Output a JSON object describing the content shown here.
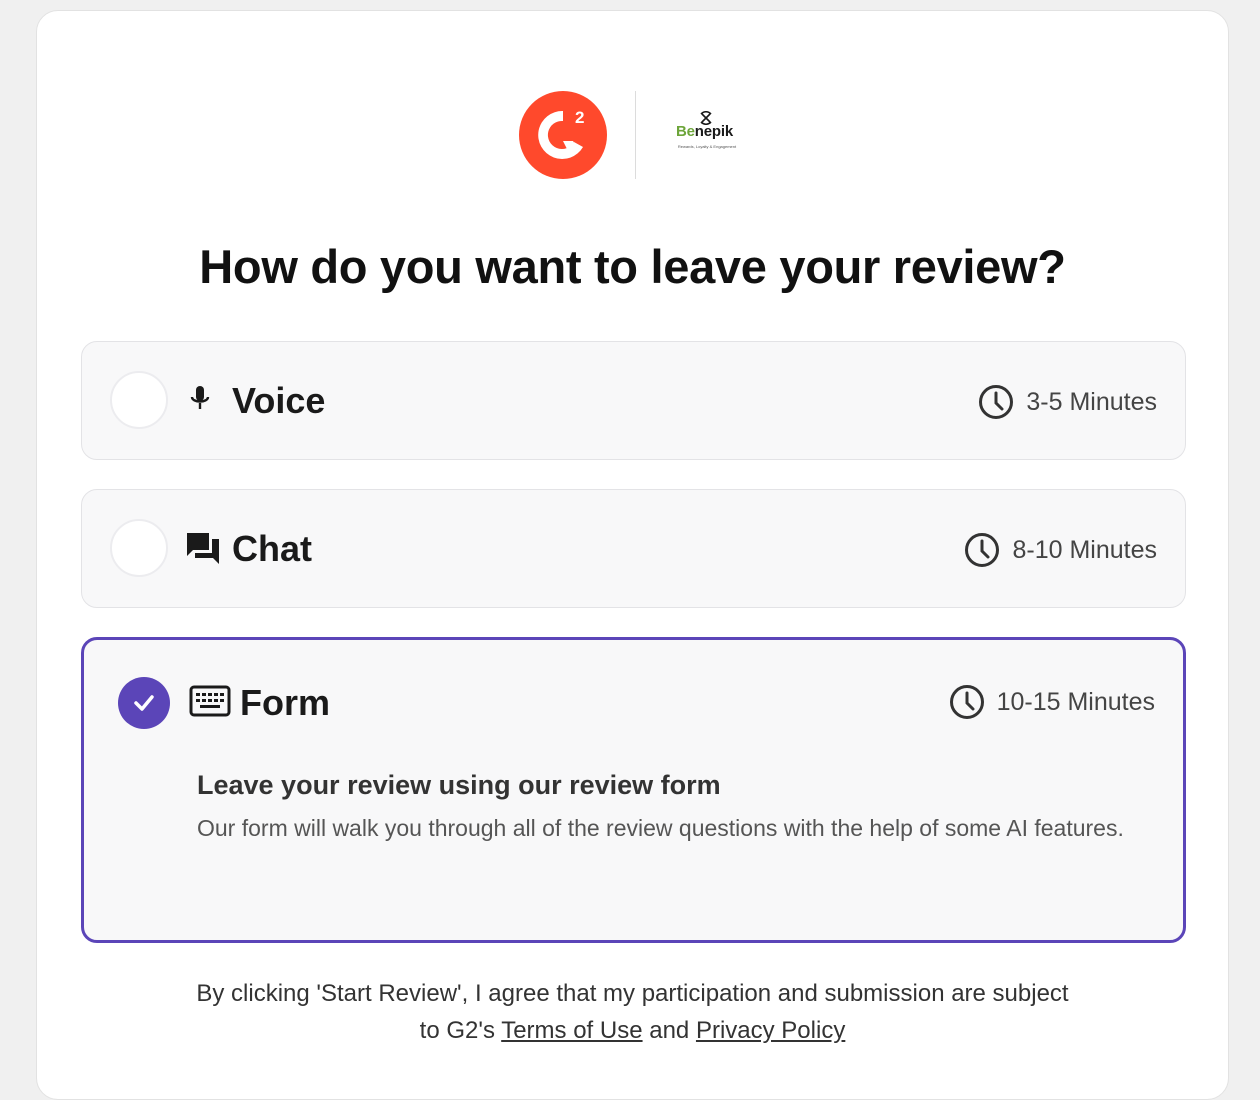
{
  "brand": {
    "g2_logo_text": "G2",
    "partner_name_prefix": "Be",
    "partner_name_suffix": "nepik",
    "partner_tagline": "Rewards, Loyalty & Engagement",
    "g2_color": "#ff492c",
    "partner_color": "#6da53a"
  },
  "heading": "How do you want to leave your review?",
  "options": [
    {
      "id": "voice",
      "label": "Voice",
      "icon": "microphone-icon",
      "time": "3-5 Minutes",
      "selected": false
    },
    {
      "id": "chat",
      "label": "Chat",
      "icon": "chat-bubbles-icon",
      "time": "8-10 Minutes",
      "selected": false
    },
    {
      "id": "form",
      "label": "Form",
      "icon": "keyboard-icon",
      "time": "10-15 Minutes",
      "selected": true,
      "description_title": "Leave your review using our review form",
      "description_body": "Our form will walk you through all of the review questions with the help of some AI features."
    }
  ],
  "footer": {
    "line1": "By clicking 'Start Review', I agree that my participation and submission are subject",
    "line2_prefix": "to G2's ",
    "terms_label": "Terms of Use",
    "and_text": " and ",
    "privacy_label": "Privacy Policy"
  },
  "colors": {
    "accent": "#5b45b8",
    "background": "#f0f0f0",
    "card": "#ffffff"
  }
}
